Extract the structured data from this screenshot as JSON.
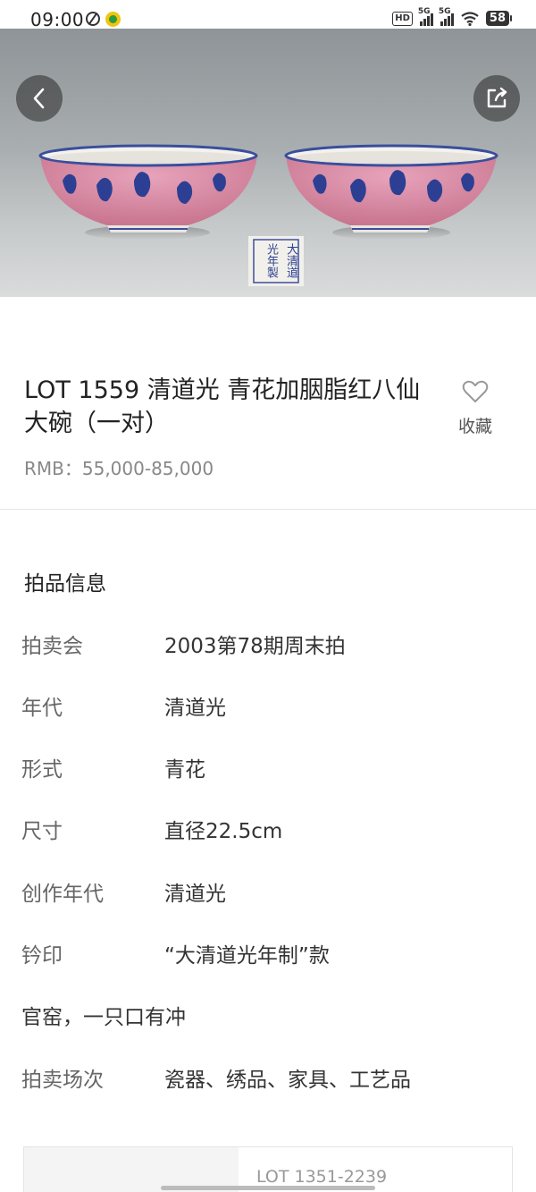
{
  "status_bar": {
    "time": "09:00",
    "hd": "HD",
    "net1": "5G",
    "net2": "5G",
    "battery": "58"
  },
  "hero": {
    "alt_description": "Pair of blue-and-white bowls with pink ground",
    "seal_text": [
      "大",
      "清",
      "道",
      "光",
      "年",
      "製"
    ],
    "colors": {
      "bowl_pink": "#d98aa6",
      "bowl_blue": "#2c3f93",
      "background": "#a9aeb0"
    }
  },
  "lot": {
    "title": "LOT 1559 清道光  青花加胭脂红八仙大碗（一对）",
    "price": "RMB：55,000-85,000",
    "favorite_label": "收藏"
  },
  "info": {
    "section_title": "拍品信息",
    "rows": [
      {
        "label": "拍卖会",
        "value": "2003第78期周末拍"
      },
      {
        "label": "年代",
        "value": "清道光"
      },
      {
        "label": "形式",
        "value": "青花"
      },
      {
        "label": "尺寸",
        "value": "直径22.5cm"
      },
      {
        "label": "创作年代",
        "value": "清道光"
      },
      {
        "label": "钤印",
        "value": "“大清道光年制”款"
      }
    ],
    "note": "官窑，一只口有冲",
    "session": {
      "label": "拍卖场次",
      "value": "瓷器、绣品、家具、工艺品"
    }
  },
  "lot_range": "LOT 1351-2239"
}
